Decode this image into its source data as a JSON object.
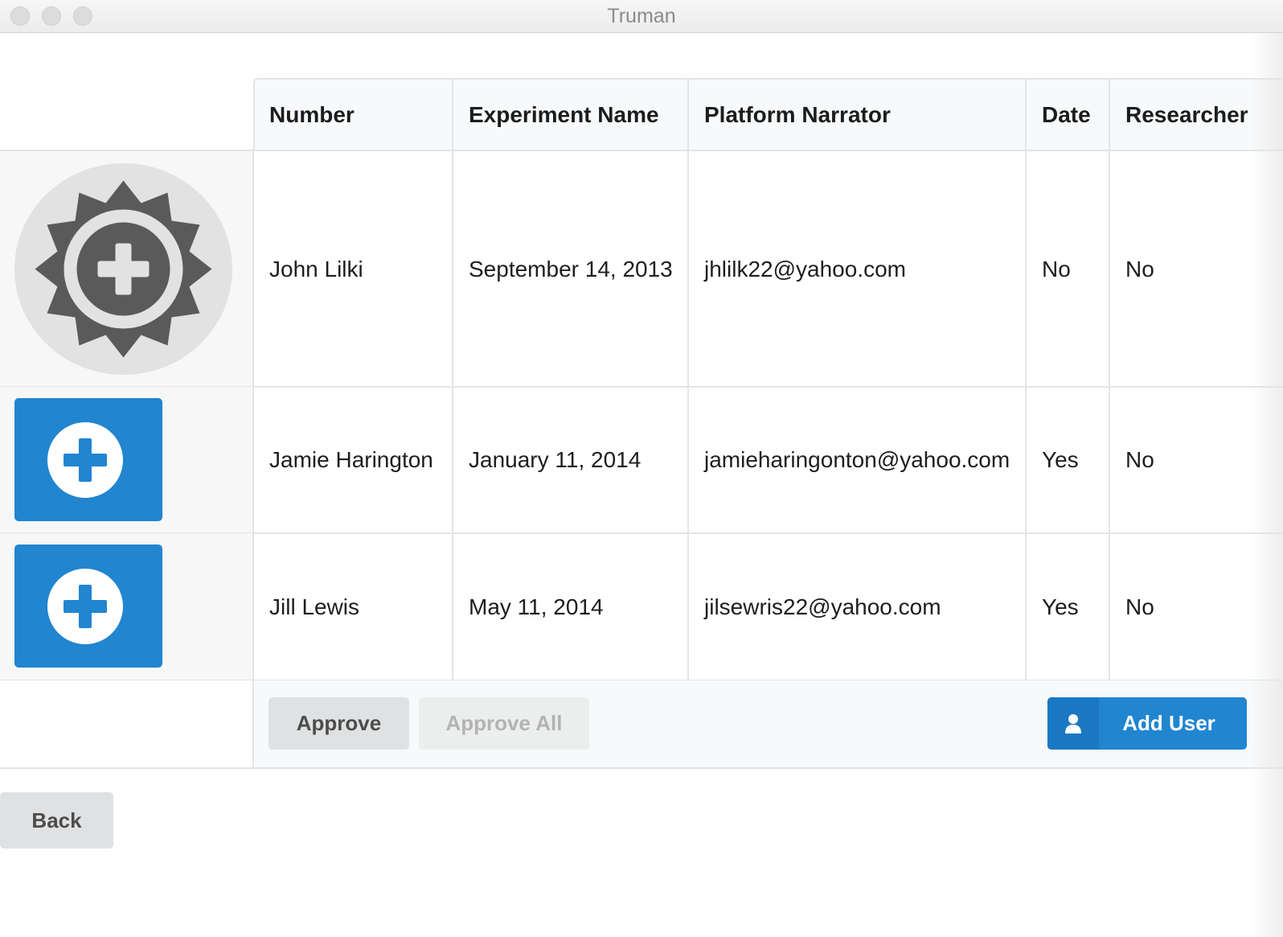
{
  "window": {
    "title": "Truman"
  },
  "table": {
    "columns": [
      "Number",
      "Experiment Name",
      "Platform Narrator",
      "Date",
      "Researcher"
    ],
    "rows": [
      {
        "thumbnail": "gear-plus-icon",
        "number": "John Lilki",
        "experiment_name": "September 14, 2013",
        "platform_narrator": "jhlilk22@yahoo.com",
        "date": "No",
        "researcher": "No"
      },
      {
        "thumbnail": "plus-circle-icon",
        "number": "Jamie Harington",
        "experiment_name": "January 11, 2014",
        "platform_narrator": "jamieharingonton@yahoo.com",
        "date": "Yes",
        "researcher": "No"
      },
      {
        "thumbnail": "plus-circle-icon",
        "number": "Jill Lewis",
        "experiment_name": "May 11, 2014",
        "platform_narrator": "jilsewris22@yahoo.com",
        "date": "Yes",
        "researcher": "No"
      }
    ]
  },
  "footer": {
    "approve_label": "Approve",
    "approve_all_label": "Approve All",
    "add_user_label": "Add User",
    "add_user_icon": "user-icon"
  },
  "back_label": "Back",
  "colors": {
    "primary": "#2185d0",
    "button_grey": "#e0e1e2",
    "disabled_text": "#b3b3b3"
  }
}
